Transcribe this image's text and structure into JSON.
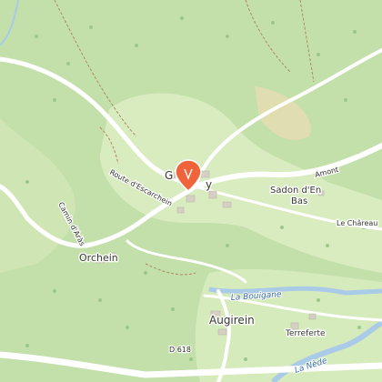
{
  "map": {
    "places": {
      "village_center": "G",
      "village_center_tail": "y",
      "orchein": "Orchein",
      "sadon_line1": "Sadon d'En",
      "sadon_line2": "Bas",
      "le_chareau": "Le Châreau",
      "augirein": "Augirein",
      "terreferte": "Terreferte"
    },
    "roads": {
      "route_escarchein": "Route d'Escarchein",
      "amont": "Amont",
      "cami_aras": "Camin d'Aràs",
      "d618": "D 618"
    },
    "water": {
      "bouigane": "La Bouigane",
      "nede": "La Nède"
    },
    "marker": {
      "icon": "map-pin-icon",
      "color": "#f0643c"
    },
    "colors": {
      "forest": "#bfdca6",
      "meadow": "#dcedc0",
      "road": "#ffffff",
      "river": "#a9cbe8",
      "building": "#d6cfc4"
    }
  }
}
